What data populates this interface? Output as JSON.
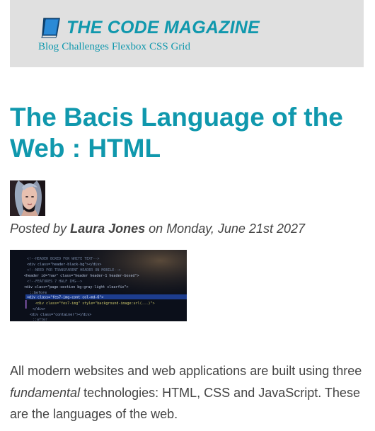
{
  "header": {
    "logo_icon": "book-icon",
    "brand_name": "THE CODE MAGAZINE",
    "nav": [
      {
        "label": "Blog"
      },
      {
        "label": "Challenges"
      },
      {
        "label": "Flexbox"
      },
      {
        "label": "CSS Grid"
      }
    ]
  },
  "article": {
    "title": "The Bacis Language of the Web : HTML",
    "byline": {
      "prefix": "Posted by",
      "author": "Laura Jones",
      "middle": "on",
      "date": "Monday, June 21st 2027"
    },
    "intro": {
      "part1": "All modern websites and web applications are built using three",
      "emphasis": "fundamental",
      "part2": "technologies: HTML, CSS and JavaScript. These are the languages of the web."
    }
  },
  "colors": {
    "accent": "#1098ad",
    "header_bg": "#e0e0e0",
    "text": "#444444"
  }
}
